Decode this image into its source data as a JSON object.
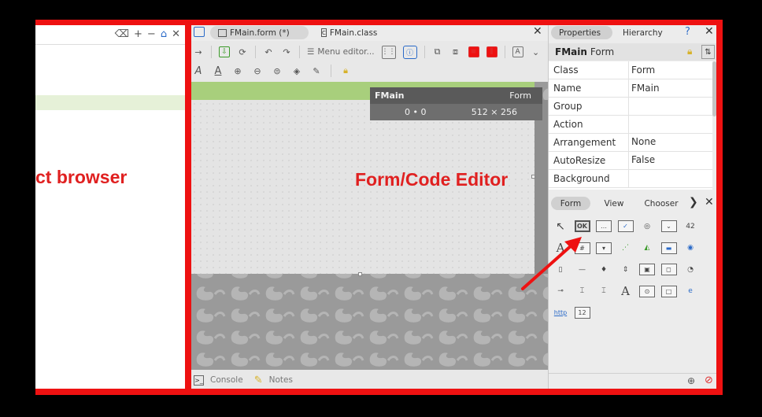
{
  "annotations": {
    "left_label": "ct browser",
    "editor_label": "Form/Code Editor"
  },
  "editor": {
    "tabs": [
      {
        "label": "FMain.form (*)"
      },
      {
        "label": "FMain.class"
      }
    ],
    "toolbar": {
      "menu_editor": "Menu editor..."
    },
    "form_info": {
      "name": "FMain",
      "type": "Form",
      "position": "0 • 0",
      "size": "512 × 256"
    },
    "bottom": {
      "console": "Console",
      "notes": "Notes"
    }
  },
  "properties": {
    "tabs": [
      "Properties",
      "Hierarchy"
    ],
    "help": "?",
    "header_name": "FMain",
    "header_type": "Form",
    "rows": [
      {
        "name": "Class",
        "value": "Form"
      },
      {
        "name": "Name",
        "value": "FMain"
      },
      {
        "name": "Group",
        "value": ""
      },
      {
        "name": "Action",
        "value": ""
      },
      {
        "name": "Arrangement",
        "value": "None"
      },
      {
        "name": "AutoResize",
        "value": "False"
      },
      {
        "name": "Background",
        "value": ""
      }
    ]
  },
  "toolbox": {
    "tabs": [
      "Form",
      "View",
      "Chooser"
    ],
    "items": [
      {
        "icon": "pointer-icon",
        "glyph": "↖"
      },
      {
        "icon": "button-ok-icon",
        "glyph": "OK"
      },
      {
        "icon": "ellipsis-button-icon",
        "glyph": "…"
      },
      {
        "icon": "checkbox-icon",
        "glyph": "✓"
      },
      {
        "icon": "picture-box-icon",
        "glyph": "◎"
      },
      {
        "icon": "combobox-icon",
        "glyph": "⌄"
      },
      {
        "icon": "lcd-number-icon",
        "glyph": "42"
      },
      {
        "icon": "label-icon",
        "glyph": "A"
      },
      {
        "icon": "grid-icon",
        "glyph": "#"
      },
      {
        "icon": "image-combo-icon",
        "glyph": "▾"
      },
      {
        "icon": "scatter-icon",
        "glyph": "⋰"
      },
      {
        "icon": "chart-icon",
        "glyph": "◭"
      },
      {
        "icon": "progress-icon",
        "glyph": "▬"
      },
      {
        "icon": "radio-icon",
        "glyph": "◉"
      },
      {
        "icon": "scrollbar-icon",
        "glyph": "▯"
      },
      {
        "icon": "separator-icon",
        "glyph": "—"
      },
      {
        "icon": "slider-icon",
        "glyph": "♦"
      },
      {
        "icon": "spin-icon",
        "glyph": "⇕"
      },
      {
        "icon": "split-icon",
        "glyph": "▣"
      },
      {
        "icon": "spinbox-icon",
        "glyph": "◻"
      },
      {
        "icon": "dial-icon",
        "glyph": "◔"
      },
      {
        "icon": "switch-icon",
        "glyph": "⊸"
      },
      {
        "icon": "textarea-icon",
        "glyph": "⌶"
      },
      {
        "icon": "textbox-icon",
        "glyph": "⌶"
      },
      {
        "icon": "text-label-icon",
        "glyph": "A"
      },
      {
        "icon": "timer-icon",
        "glyph": "⊙"
      },
      {
        "icon": "frame-icon",
        "glyph": "□"
      },
      {
        "icon": "webview-icon",
        "glyph": "e"
      },
      {
        "icon": "url-label-icon",
        "glyph": "http"
      },
      {
        "icon": "value-box-icon",
        "glyph": "12"
      }
    ]
  },
  "colors": {
    "frame_red": "#ee1111",
    "label_red": "#e02020",
    "form_title_green": "#a8cf7c"
  }
}
